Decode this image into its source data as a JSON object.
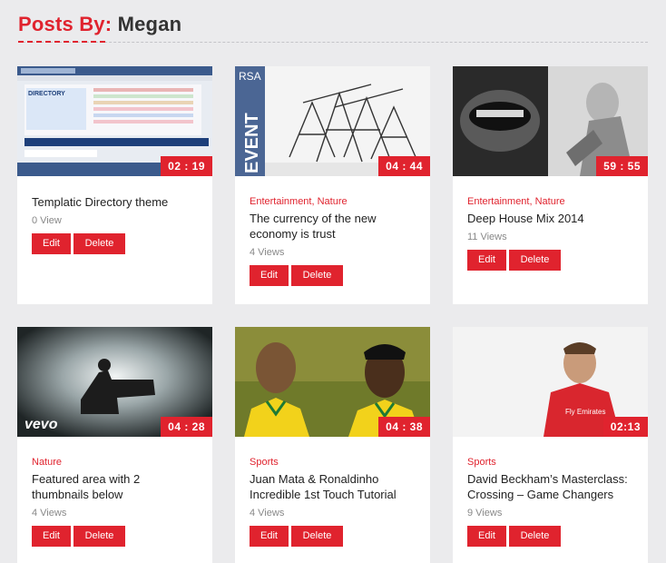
{
  "header": {
    "prefix": "Posts By:",
    "author": "Megan"
  },
  "posts": [
    {
      "duration": "02 : 19",
      "categories": "",
      "title": "Templatic Directory theme",
      "views": "0 View",
      "edit_label": "Edit",
      "delete_label": "Delete",
      "thumb_text": "DIRECTORY"
    },
    {
      "duration": "04 : 44",
      "categories": "Entertainment, Nature",
      "title": "The currency of the new economy is trust",
      "views": "4 Views",
      "edit_label": "Edit",
      "delete_label": "Delete",
      "thumb_text_top": "RSA",
      "thumb_text_side": "EVENT"
    },
    {
      "duration": "59 : 55",
      "categories": "Entertainment, Nature",
      "title": "Deep House Mix 2014",
      "views": "11 Views",
      "edit_label": "Edit",
      "delete_label": "Delete"
    },
    {
      "duration": "04 : 28",
      "categories": "Nature",
      "title": "Featured area with 2 thumbnails below",
      "views": "4 Views",
      "edit_label": "Edit",
      "delete_label": "Delete",
      "thumb_text": "vevo"
    },
    {
      "duration": "04 : 38",
      "categories": "Sports",
      "title": "Juan Mata & Ronaldinho Incredible 1st Touch Tutorial",
      "views": "4 Views",
      "edit_label": "Edit",
      "delete_label": "Delete"
    },
    {
      "duration": "02:13",
      "categories": "Sports",
      "title": "David Beckham’s Masterclass: Crossing – Game Changers",
      "views": "9 Views",
      "edit_label": "Edit",
      "delete_label": "Delete",
      "thumb_text": "Fly Emirates"
    }
  ],
  "colors": {
    "accent": "#e0232e",
    "background": "#ebebed",
    "card": "#ffffff"
  }
}
